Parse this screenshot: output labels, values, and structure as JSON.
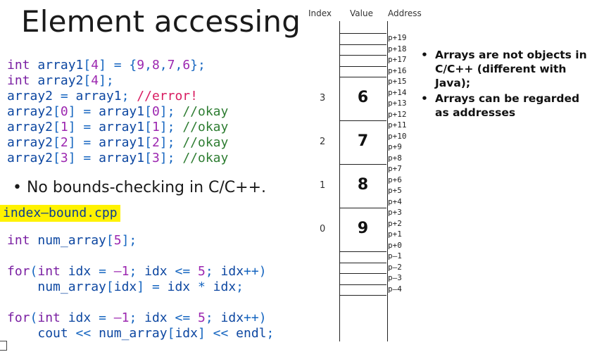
{
  "title": "Element accessing",
  "code1": [
    {
      "parts": [
        [
          "kw",
          "int "
        ],
        [
          "id",
          "array1"
        ],
        [
          "punct",
          "["
        ],
        [
          "num",
          "4"
        ],
        [
          "punct",
          "] = {"
        ],
        [
          "num",
          "9"
        ],
        [
          "punct",
          ","
        ],
        [
          "num",
          "8"
        ],
        [
          "punct",
          ","
        ],
        [
          "num",
          "7"
        ],
        [
          "punct",
          ","
        ],
        [
          "num",
          "6"
        ],
        [
          "punct",
          "};"
        ]
      ]
    },
    {
      "parts": [
        [
          "kw",
          "int "
        ],
        [
          "id",
          "array2"
        ],
        [
          "punct",
          "["
        ],
        [
          "num",
          "4"
        ],
        [
          "punct",
          "];"
        ]
      ]
    },
    {
      "parts": [
        [
          "id",
          "array2"
        ],
        [
          "punct",
          " = "
        ],
        [
          "id",
          "array1"
        ],
        [
          "punct",
          "; "
        ],
        [
          "err",
          "//error!"
        ]
      ]
    },
    {
      "parts": [
        [
          "id",
          "array2"
        ],
        [
          "punct",
          "["
        ],
        [
          "num",
          "0"
        ],
        [
          "punct",
          "] = "
        ],
        [
          "id",
          "array1"
        ],
        [
          "punct",
          "["
        ],
        [
          "num",
          "0"
        ],
        [
          "punct",
          "]; "
        ],
        [
          "ok",
          "//okay"
        ]
      ]
    },
    {
      "parts": [
        [
          "id",
          "array2"
        ],
        [
          "punct",
          "["
        ],
        [
          "num",
          "1"
        ],
        [
          "punct",
          "] = "
        ],
        [
          "id",
          "array1"
        ],
        [
          "punct",
          "["
        ],
        [
          "num",
          "1"
        ],
        [
          "punct",
          "]; "
        ],
        [
          "ok",
          "//okay"
        ]
      ]
    },
    {
      "parts": [
        [
          "id",
          "array2"
        ],
        [
          "punct",
          "["
        ],
        [
          "num",
          "2"
        ],
        [
          "punct",
          "] = "
        ],
        [
          "id",
          "array1"
        ],
        [
          "punct",
          "["
        ],
        [
          "num",
          "2"
        ],
        [
          "punct",
          "]; "
        ],
        [
          "ok",
          "//okay"
        ]
      ]
    },
    {
      "parts": [
        [
          "id",
          "array2"
        ],
        [
          "punct",
          "["
        ],
        [
          "num",
          "3"
        ],
        [
          "punct",
          "] = "
        ],
        [
          "id",
          "array1"
        ],
        [
          "punct",
          "["
        ],
        [
          "num",
          "3"
        ],
        [
          "punct",
          "]; "
        ],
        [
          "ok",
          "//okay"
        ]
      ]
    }
  ],
  "bullet": "• No bounds-checking in C/C++.",
  "filename": "index–bound.cpp",
  "code2": [
    {
      "parts": [
        [
          "kw",
          "int "
        ],
        [
          "id",
          "num_array"
        ],
        [
          "punct",
          "["
        ],
        [
          "num",
          "5"
        ],
        [
          "punct",
          "];"
        ]
      ]
    },
    {
      "parts": []
    },
    {
      "parts": [
        [
          "kw",
          "for"
        ],
        [
          "punct",
          "("
        ],
        [
          "kw",
          "int "
        ],
        [
          "id",
          "idx"
        ],
        [
          "punct",
          " = "
        ],
        [
          "num",
          "–1"
        ],
        [
          "punct",
          "; "
        ],
        [
          "id",
          "idx"
        ],
        [
          "punct",
          " <= "
        ],
        [
          "num",
          "5"
        ],
        [
          "punct",
          "; "
        ],
        [
          "id",
          "idx"
        ],
        [
          "punct",
          "++)"
        ]
      ]
    },
    {
      "parts": [
        [
          "punct",
          "    "
        ],
        [
          "id",
          "num_array"
        ],
        [
          "punct",
          "["
        ],
        [
          "id",
          "idx"
        ],
        [
          "punct",
          "] = "
        ],
        [
          "id",
          "idx"
        ],
        [
          "punct",
          " * "
        ],
        [
          "id",
          "idx"
        ],
        [
          "punct",
          ";"
        ]
      ]
    },
    {
      "parts": []
    },
    {
      "parts": [
        [
          "kw",
          "for"
        ],
        [
          "punct",
          "("
        ],
        [
          "kw",
          "int "
        ],
        [
          "id",
          "idx"
        ],
        [
          "punct",
          " = "
        ],
        [
          "num",
          "–1"
        ],
        [
          "punct",
          "; "
        ],
        [
          "id",
          "idx"
        ],
        [
          "punct",
          " <= "
        ],
        [
          "num",
          "5"
        ],
        [
          "punct",
          "; "
        ],
        [
          "id",
          "idx"
        ],
        [
          "punct",
          "++)"
        ]
      ]
    },
    {
      "parts": [
        [
          "punct",
          "    "
        ],
        [
          "id",
          "cout"
        ],
        [
          "punct",
          " << "
        ],
        [
          "id",
          "num_array"
        ],
        [
          "punct",
          "["
        ],
        [
          "id",
          "idx"
        ],
        [
          "punct",
          "] << "
        ],
        [
          "id",
          "endl"
        ],
        [
          "punct",
          ";"
        ]
      ]
    }
  ],
  "headers": {
    "index": "Index",
    "value": "Value",
    "address": "Address"
  },
  "addresses": [
    "p+19",
    "p+18",
    "p+17",
    "p+16",
    "p+15",
    "p+14",
    "p+13",
    "p+12",
    "p+11",
    "p+10",
    "p+9",
    "p+8",
    "p+7",
    "p+6",
    "p+5",
    "p+4",
    "p+3",
    "p+2",
    "p+1",
    "p+0",
    "p–1",
    "p–2",
    "p–3",
    "p–4"
  ],
  "elements": [
    {
      "index": "3",
      "value": "6"
    },
    {
      "index": "2",
      "value": "7"
    },
    {
      "index": "1",
      "value": "8"
    },
    {
      "index": "0",
      "value": "9"
    }
  ],
  "notes": [
    "Arrays are not objects in C/C++ (different with Java);",
    "Arrays can be regarded as addresses"
  ],
  "colors": {
    "highlight": "#fff200",
    "ok": "#2e7d32",
    "error": "#d81b60"
  }
}
